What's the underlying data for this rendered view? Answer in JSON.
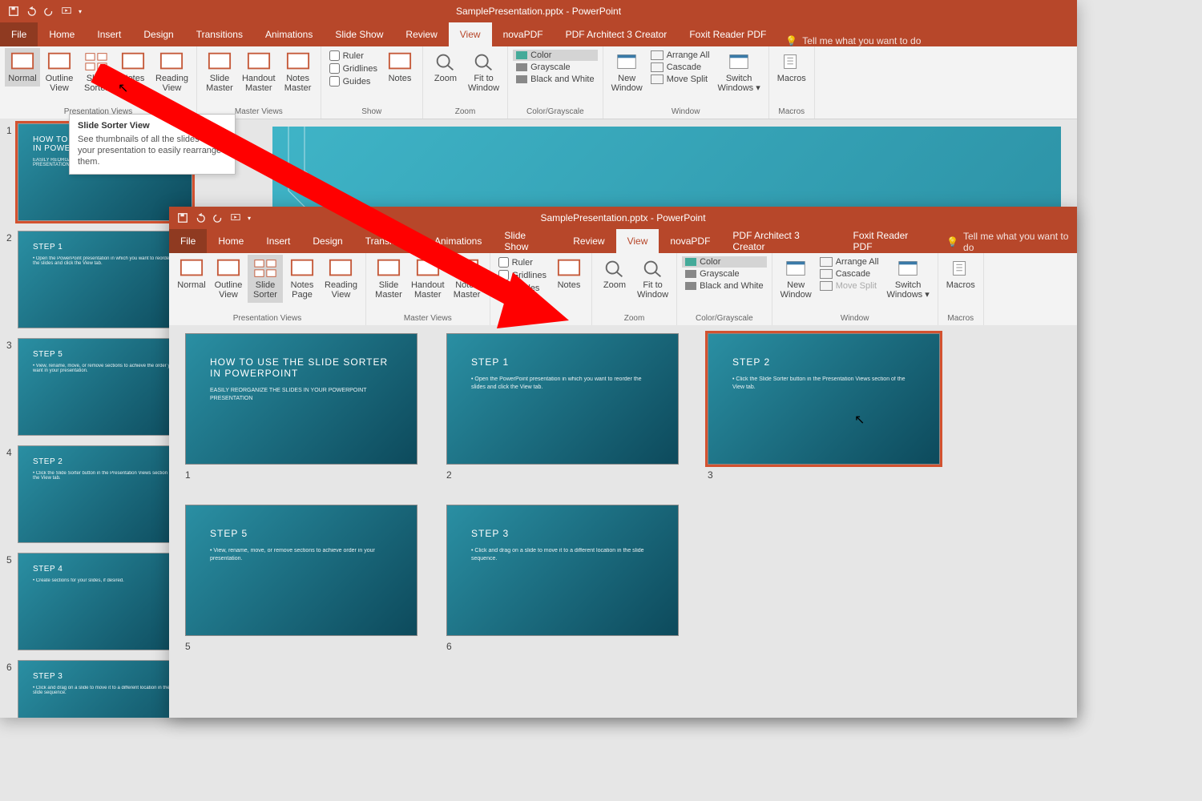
{
  "app": {
    "title": "SamplePresentation.pptx - PowerPoint"
  },
  "tabs": [
    "File",
    "Home",
    "Insert",
    "Design",
    "Transitions",
    "Animations",
    "Slide Show",
    "Review",
    "View",
    "novaPDF",
    "PDF Architect 3 Creator",
    "Foxit Reader PDF"
  ],
  "active_tab": "View",
  "tellme": "Tell me what you want to do",
  "ribbon": {
    "presentation_views": {
      "label": "Presentation Views",
      "items": [
        "Normal",
        "Outline View",
        "Slide Sorter",
        "Notes Page",
        "Reading View"
      ]
    },
    "master_views": {
      "label": "Master Views",
      "items": [
        "Slide Master",
        "Handout Master",
        "Notes Master"
      ]
    },
    "show": {
      "label": "Show",
      "items": [
        "Ruler",
        "Gridlines",
        "Guides"
      ],
      "notes": "Notes"
    },
    "zoom": {
      "label": "Zoom",
      "items": [
        "Zoom",
        "Fit to Window"
      ]
    },
    "color": {
      "label": "Color/Grayscale",
      "items": [
        "Color",
        "Grayscale",
        "Black and White"
      ]
    },
    "window": {
      "label": "Window",
      "new": "New Window",
      "items": [
        "Arrange All",
        "Cascade",
        "Move Split"
      ],
      "switch": "Switch Windows"
    },
    "macros": {
      "label": "Macros",
      "item": "Macros"
    }
  },
  "tooltip": {
    "title": "Slide Sorter View",
    "body": "See thumbnails of all the slides in your presentation to easily rearrange them."
  },
  "left_thumbs": [
    {
      "n": "1",
      "title": "HOW TO USE THE SLIDE SORTER IN POWERPOINT",
      "body": "EASILY REORGANIZE THE SLIDES IN YOUR POWERPOINT PRESENTATION",
      "sel": true
    },
    {
      "n": "2",
      "title": "STEP 1",
      "body": "• Open the PowerPoint presentation in which you want to reorder the slides and click the View tab."
    },
    {
      "n": "3",
      "title": "STEP 5",
      "body": "• View, rename, move, or remove sections to achieve the order you want in your presentation."
    },
    {
      "n": "4",
      "title": "STEP 2",
      "body": "• Click the Slide Sorter button in the Presentation Views section of the View tab."
    },
    {
      "n": "5",
      "title": "STEP 4",
      "body": "• Create sections for your slides, if desired."
    },
    {
      "n": "6",
      "title": "STEP 3",
      "body": "• Click and drag on a slide to move it to a different location in the slide sequence."
    }
  ],
  "sorter_slides": [
    {
      "n": "1",
      "title": "HOW TO USE THE SLIDE SORTER IN POWERPOINT",
      "body": "EASILY REORGANIZE THE SLIDES IN YOUR POWERPOINT PRESENTATION"
    },
    {
      "n": "2",
      "title": "STEP 1",
      "body": "• Open the PowerPoint presentation in which you want to reorder the slides and click the View tab."
    },
    {
      "n": "3",
      "title": "STEP 2",
      "body": "• Click the Slide Sorter button in the Presentation Views section of the View tab.",
      "sel": true
    },
    {
      "n": "5",
      "title": "STEP 5",
      "body": "• View, rename, move, or remove sections to achieve order in your presentation."
    },
    {
      "n": "6",
      "title": "STEP 3",
      "body": "• Click and drag on a slide to move it to a different location in the slide sequence."
    }
  ]
}
